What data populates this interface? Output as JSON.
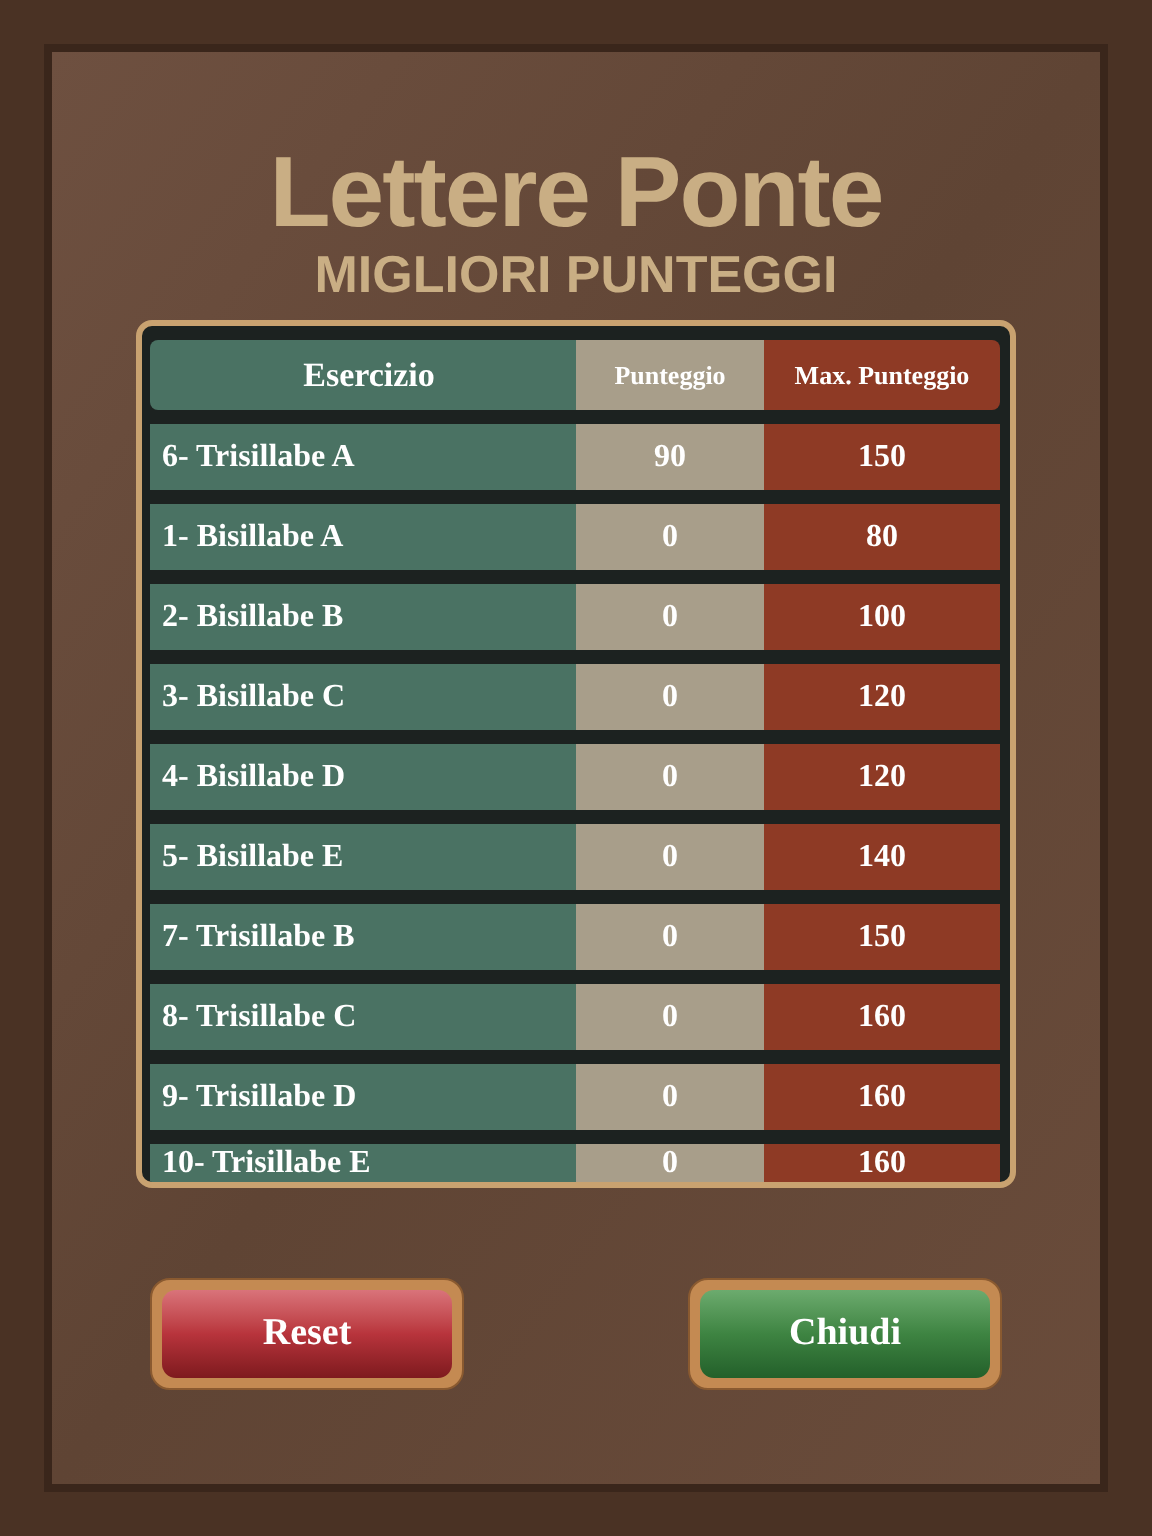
{
  "title": "Lettere Ponte",
  "subtitle": "MIGLIORI PUNTEGGI",
  "table": {
    "columns": [
      "Esercizio",
      "Punteggio",
      "Max. Punteggio"
    ],
    "rows": [
      [
        "6- Trisillabe A",
        "90",
        "150"
      ],
      [
        "1- Bisillabe A",
        "0",
        "80"
      ],
      [
        "2- Bisillabe B",
        "0",
        "100"
      ],
      [
        "3- Bisillabe C",
        "0",
        "120"
      ],
      [
        "4- Bisillabe D",
        "0",
        "120"
      ],
      [
        "5- Bisillabe E",
        "0",
        "140"
      ],
      [
        "7- Trisillabe B",
        "0",
        "150"
      ],
      [
        "8- Trisillabe C",
        "0",
        "160"
      ],
      [
        "9- Trisillabe D",
        "0",
        "160"
      ],
      [
        "10- Trisillabe E",
        "0",
        "160"
      ]
    ]
  },
  "buttons": [
    {
      "label": "Reset",
      "kind": "danger"
    },
    {
      "label": "Chiudi",
      "kind": "confirm"
    }
  ]
}
